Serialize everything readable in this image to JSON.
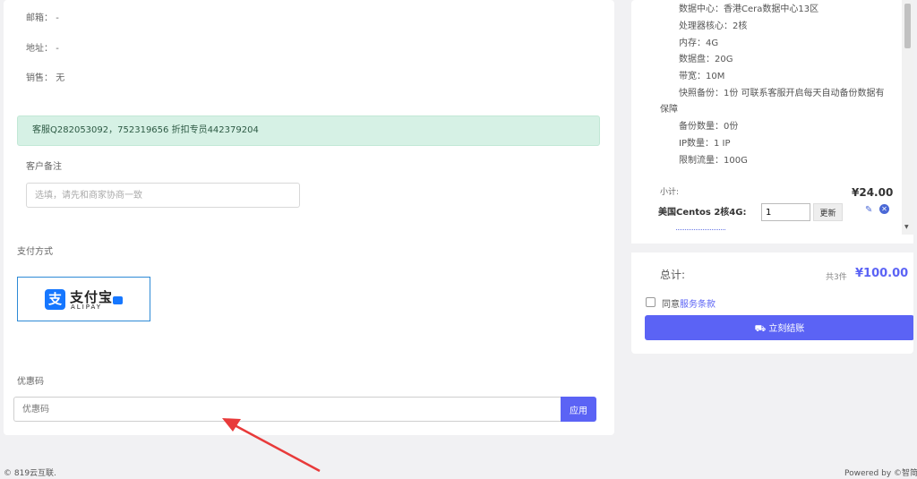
{
  "customer_info": {
    "email_label": "邮箱：",
    "email_value": "-",
    "address_label": "地址：",
    "address_value": "-",
    "sales_label": "销售：",
    "sales_value": "无"
  },
  "notice": "客服Q282053092，752319656 折扣专员442379204",
  "remark": {
    "label": "客户备注",
    "placeholder": "选填，请先和商家协商一致"
  },
  "payment": {
    "label": "支付方式",
    "method_name": "支付宝",
    "method_name_en": "ALIPAY"
  },
  "coupon": {
    "label": "优惠码",
    "placeholder": "优惠码",
    "apply_label": "应用"
  },
  "order_summary": {
    "specs": [
      "数据中心：香港Cera数据中心13区",
      "处理器核心：2核",
      "内存：4G",
      "数据盘：20G",
      "带宽：10M",
      "快照备份：1份 可联系客服开启每天自动备份数据有",
      "保障",
      "备份数量：0份",
      "IP数量：1 IP",
      "限制流量：100G"
    ],
    "subtotal_label": "小计:",
    "subtotal_value": "¥24.00",
    "item_name": "美国Centos 2核4G:",
    "item_qty": "1",
    "update_label": "更新",
    "total_label": "总计:",
    "total_count": "共3件",
    "total_value": "¥100.00",
    "agree_prefix": "同意",
    "terms_link": "服务条款",
    "checkout_label": "立刻结账"
  },
  "footer": {
    "copyright": "© 819云互联.",
    "powered_by": "Powered by ©智简"
  },
  "colors": {
    "accent": "#5b63f5",
    "notice_bg": "#d6f1e5",
    "alipay_blue": "#1677ff",
    "annotation_arrow": "#e83a3a"
  },
  "icons": {
    "edit": "pencil-icon",
    "delete": "close-circle-icon",
    "checkout": "truck-icon",
    "alipay": "alipay-logo-icon"
  }
}
